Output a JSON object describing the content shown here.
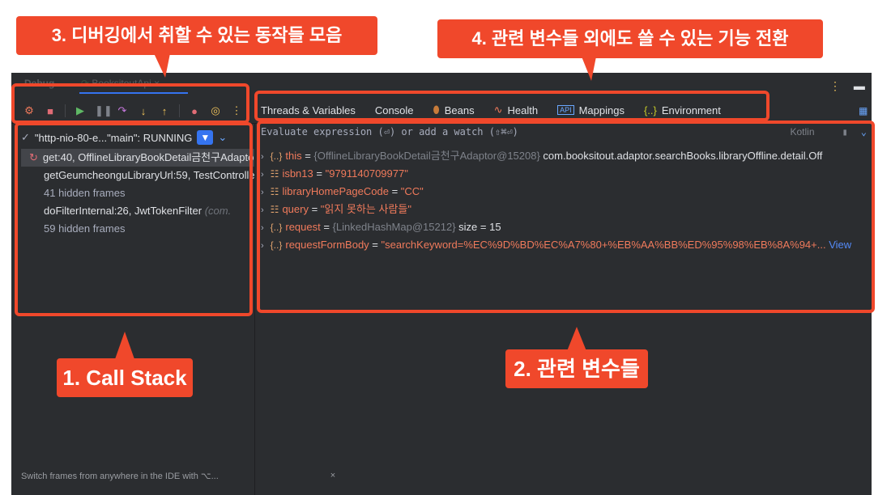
{
  "debug_window": {
    "tab_title": "Debug",
    "run_config": "BooksitoutApi",
    "thread": {
      "text": "\"http-nio-80-e...\"main\": RUNNING"
    },
    "frames": [
      {
        "text": "get:40, OfflineLibraryBookDetail금천구Adaptor",
        "pkg": ""
      },
      {
        "text": "getGeumcheonguLibraryUrl:59, TestController",
        "pkg": ""
      },
      {
        "text": "41 hidden frames",
        "pkg": ""
      },
      {
        "text": "doFilterInternal:26, JwtTokenFilter",
        "pkg": "(com."
      },
      {
        "text": "59 hidden frames",
        "pkg": ""
      }
    ],
    "view_tabs": [
      "Threads & Variables",
      "Console",
      "Beans",
      "Health",
      "Mappings",
      "Environment"
    ],
    "evaluate": {
      "placeholder": "Evaluate expression (⏎) or add a watch (⇧⌘⏎)",
      "language": "Kotlin"
    },
    "variables": [
      {
        "name": "this",
        "eq": " = ",
        "ref": "{OfflineLibraryBookDetail금천구Adaptor@15208}",
        "value": " com.booksitout.adaptor.searchBooks.libraryOffline.detail.Off"
      },
      {
        "name": "isbn13",
        "eq": " = ",
        "ref": "",
        "value": "\"9791140709977\""
      },
      {
        "name": "libraryHomePageCode",
        "eq": " = ",
        "ref": "",
        "value": "\"CC\""
      },
      {
        "name": "query",
        "eq": " = ",
        "ref": "",
        "value": "\"읽지 못하는 사람들\""
      },
      {
        "name": "request",
        "eq": " = ",
        "ref": "{LinkedHashMap@15212}",
        "value": "  size = 15"
      },
      {
        "name": "requestFormBody",
        "eq": " = ",
        "ref": "",
        "value": "\"searchKeyword=%EC%9D%BD%EC%A7%80+%EB%AA%BB%ED%95%98%EB%8A%94+...",
        "link": "View"
      }
    ],
    "status_bar": "Switch frames from anywhere in the IDE with ⌥..."
  },
  "annotations": {
    "call_stack": "1. Call Stack",
    "variables": "2. 관련 변수들",
    "actions": "3. 디버깅에서 취할 수 있는 동작들 모음",
    "other_vars": "4. 관련 변수들 외에도 쓸 수 있는 기능 전환"
  },
  "colors": {
    "annotation": "#f0482b",
    "panel_bg": "#2b2d30",
    "accent": "#3574f0"
  }
}
